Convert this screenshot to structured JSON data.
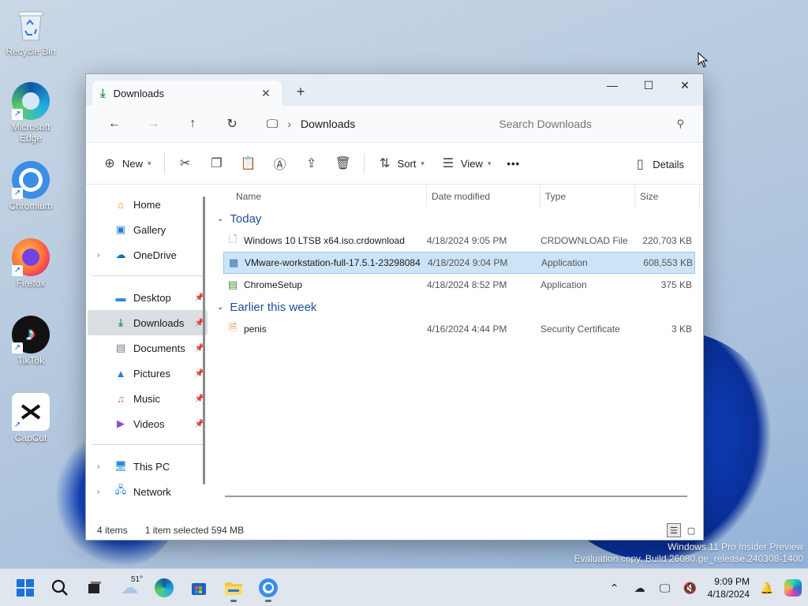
{
  "desktop": {
    "icons": [
      {
        "label": "Recycle Bin",
        "icon": "recycle-bin-icon"
      },
      {
        "label": "Microsoft Edge",
        "icon": "edge-icon"
      },
      {
        "label": "Chromium",
        "icon": "chromium-icon"
      },
      {
        "label": "Firefox",
        "icon": "firefox-icon"
      },
      {
        "label": "TikTok",
        "icon": "tiktok-icon"
      },
      {
        "label": "CapCut",
        "icon": "capcut-icon"
      }
    ],
    "watermark": {
      "line1": "Windows 11 Pro Insider Preview",
      "line2": "Evaluation copy. Build 26080.ge_release.240308-1400"
    }
  },
  "window": {
    "tab": {
      "label": "Downloads",
      "close": "✕",
      "new_tab": "+"
    },
    "controls": {
      "minimize": "—",
      "maximize": "☐",
      "close": "✕"
    },
    "address": {
      "path": "Downloads",
      "search_placeholder": "Search Downloads"
    },
    "toolbar": {
      "new_label": "New",
      "sort_label": "Sort",
      "view_label": "View",
      "more_label": "•••",
      "details_label": "Details"
    },
    "sidebar": {
      "top": [
        {
          "label": "Home",
          "icon": "home-icon"
        },
        {
          "label": "Gallery",
          "icon": "gallery-icon"
        },
        {
          "label": "OneDrive",
          "icon": "onedrive-icon"
        }
      ],
      "pinned": [
        {
          "label": "Desktop",
          "icon": "desktop-icon"
        },
        {
          "label": "Downloads",
          "icon": "downloads-icon"
        },
        {
          "label": "Documents",
          "icon": "documents-icon"
        },
        {
          "label": "Pictures",
          "icon": "pictures-icon"
        },
        {
          "label": "Music",
          "icon": "music-icon"
        },
        {
          "label": "Videos",
          "icon": "videos-icon"
        }
      ],
      "bottom": [
        {
          "label": "This PC",
          "icon": "this-pc-icon"
        },
        {
          "label": "Network",
          "icon": "network-icon"
        }
      ]
    },
    "columns": {
      "name": "Name",
      "date": "Date modified",
      "type": "Type",
      "size": "Size"
    },
    "groups": [
      {
        "title": "Today",
        "files": [
          {
            "name": "Windows 10 LTSB x64.iso.crdownload",
            "date": "4/18/2024 9:05 PM",
            "type": "CRDOWNLOAD File",
            "size": "220,703 KB"
          },
          {
            "name": "VMware-workstation-full-17.5.1-23298084",
            "date": "4/18/2024 9:04 PM",
            "type": "Application",
            "size": "608,553 KB"
          },
          {
            "name": "ChromeSetup",
            "date": "4/18/2024 8:52 PM",
            "type": "Application",
            "size": "375 KB"
          }
        ]
      },
      {
        "title": "Earlier this week",
        "files": [
          {
            "name": "penis",
            "date": "4/16/2024 4:44 PM",
            "type": "Security Certificate",
            "size": "3 KB"
          }
        ]
      }
    ],
    "status": {
      "count": "4 items",
      "selected": "1 item selected  594 MB"
    }
  },
  "taskbar": {
    "weather": "51°",
    "clock_time": "9:09 PM",
    "clock_date": "4/18/2024"
  }
}
